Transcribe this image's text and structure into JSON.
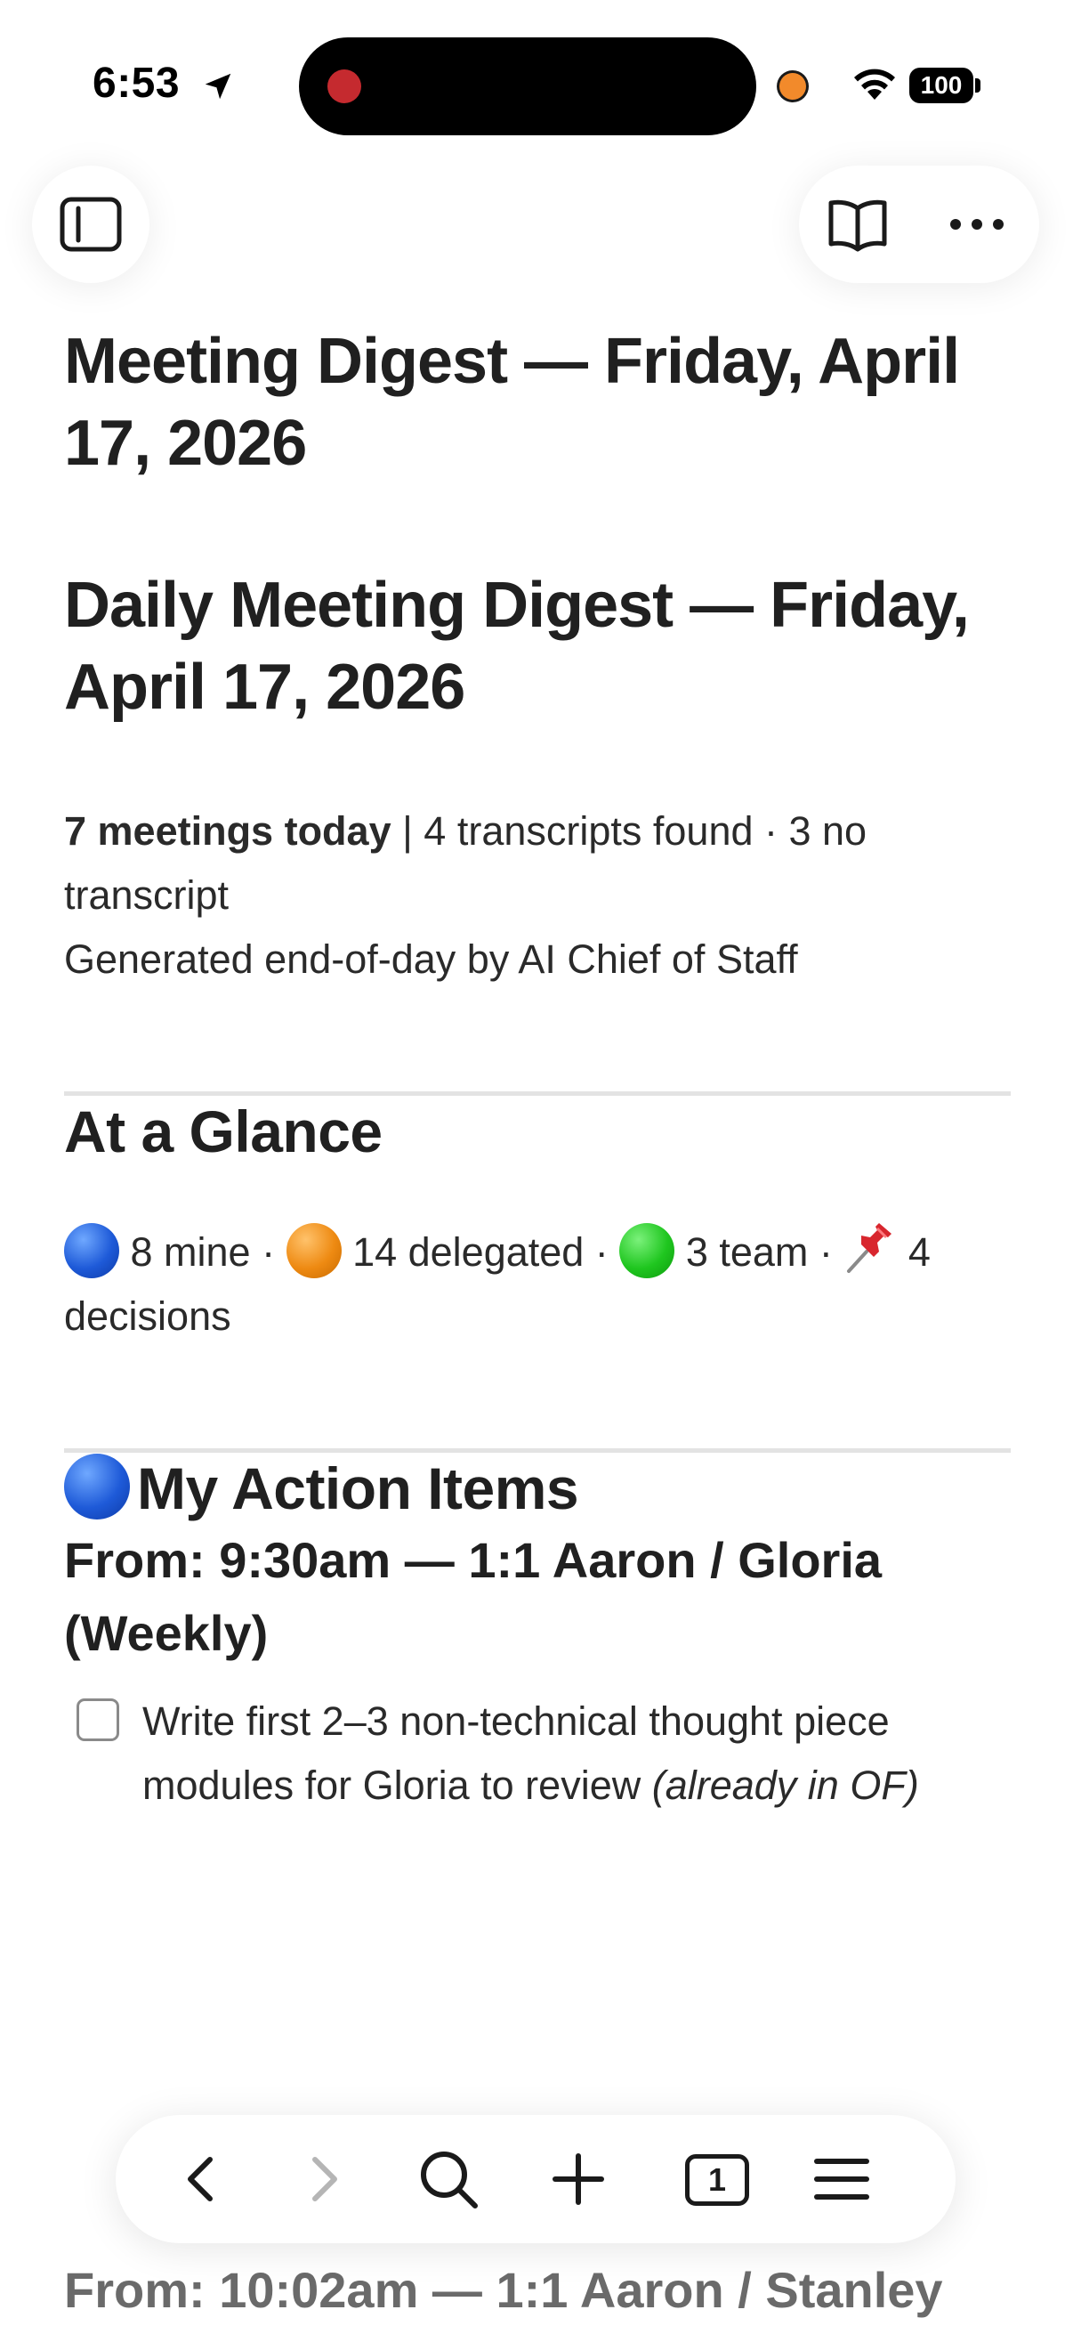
{
  "status_bar": {
    "time": "6:53",
    "battery": "100"
  },
  "icons": {
    "sidebar": "sidebar-icon",
    "reader": "book-open-icon",
    "more": "ellipsis-icon",
    "back": "chevron-left-icon",
    "forward": "chevron-right-icon",
    "search": "search-icon",
    "new_tab": "plus-icon",
    "tabs": "tabs-icon",
    "menu": "menu-icon"
  },
  "document": {
    "title": "Meeting Digest — Friday, April 17, 2026",
    "digest_title": "Daily Meeting Digest — Friday, April 17, 2026",
    "summary": {
      "meetings_bold": "7 meetings today",
      "counts": " | 4 transcripts found · 3 no transcript",
      "generated_by": "Generated end-of-day by AI Chief of Staff"
    },
    "glance": {
      "heading": "At a Glance",
      "mine": " 8 mine · ",
      "delegated": " 14 delegated · ",
      "team": " 3 team · ",
      "decisions": " 4 decisions"
    },
    "action_items": {
      "heading": "My Action Items",
      "groups": [
        {
          "from": "From: 9:30am — 1:1 Aaron / Gloria (Weekly)",
          "tasks": [
            {
              "text": "Write first 2–3 non-technical thought piece modules for Gloria to review ",
              "note": "(already in OF)",
              "checked": false
            }
          ]
        },
        {
          "from": "From: 10:02am — 1:1 Aaron / Stanley"
        }
      ]
    }
  },
  "toolbar": {
    "tab_count": "1"
  },
  "colors": {
    "mine": "#1e5ad8",
    "delegated": "#ee8a12",
    "team": "#1fc61f",
    "recording": "#c52a2f",
    "indicator": "#f28a2b"
  }
}
